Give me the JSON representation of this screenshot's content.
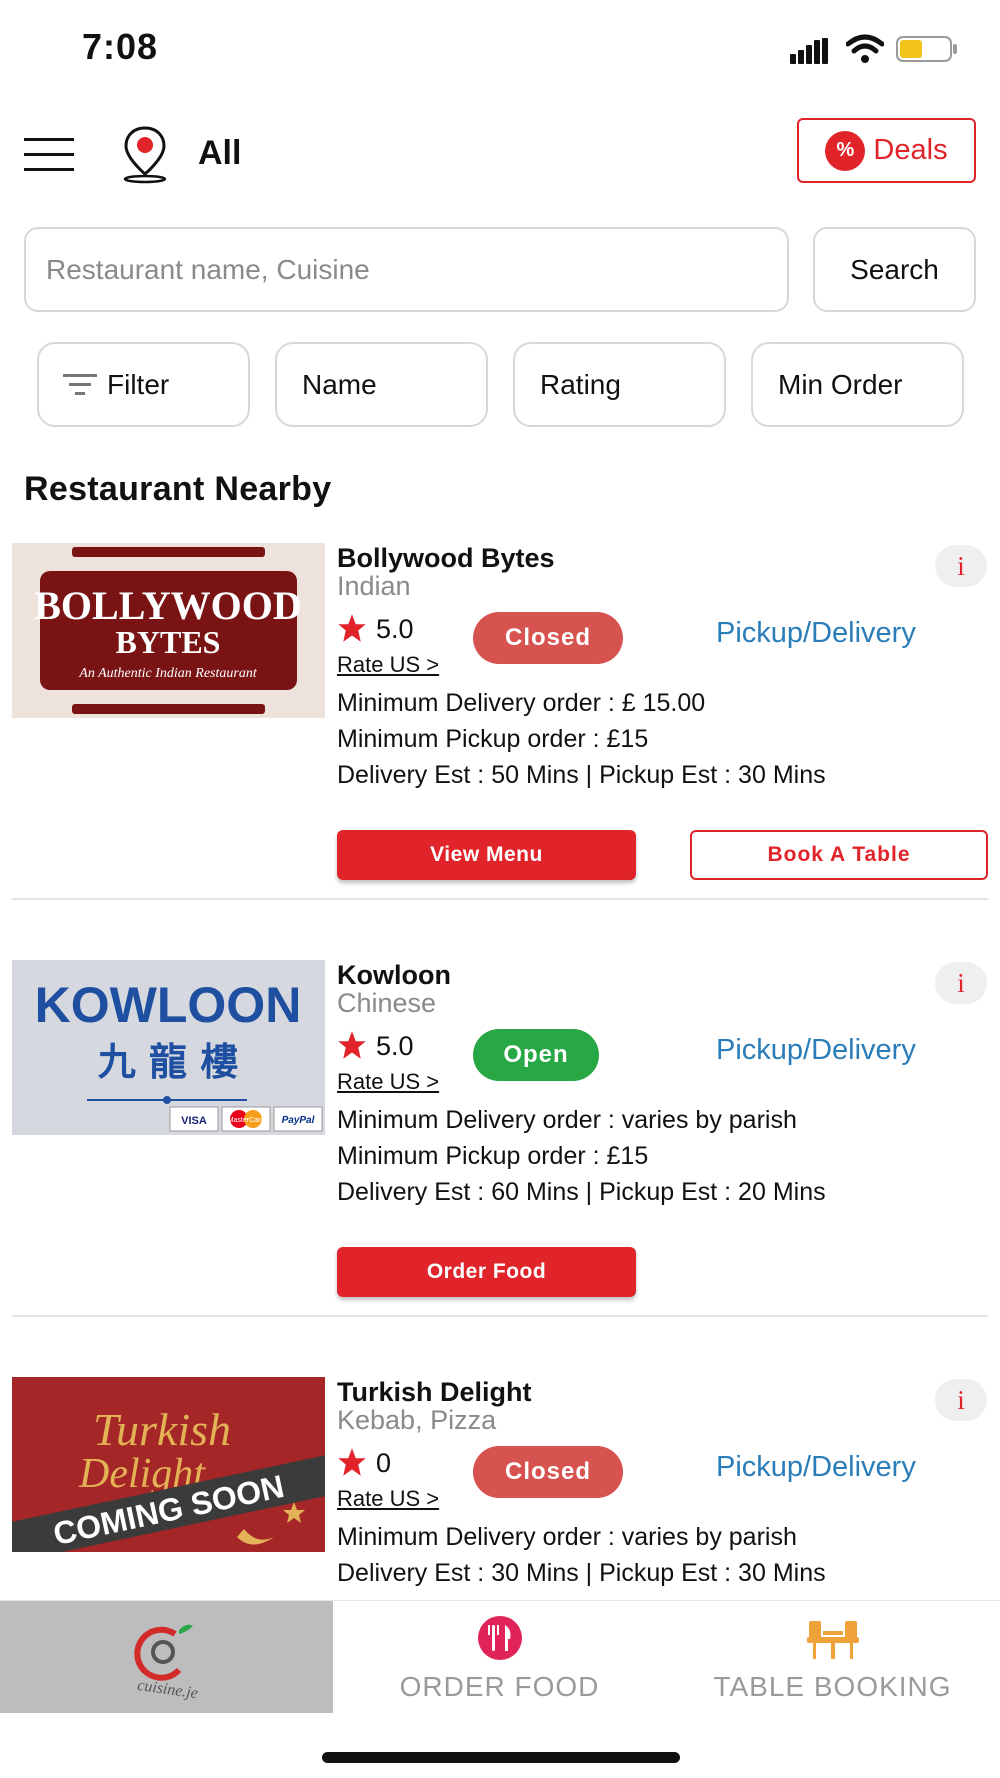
{
  "status_bar": {
    "time": "7:08"
  },
  "header": {
    "location": "All",
    "deals_label": "Deals",
    "deals_badge": "%"
  },
  "search": {
    "placeholder": "Restaurant name, Cuisine",
    "value": "",
    "button_label": "Search"
  },
  "sort_chips": {
    "filter": "Filter",
    "name": "Name",
    "rating": "Rating",
    "min_order": "Min Order"
  },
  "section_title": "Restaurant Nearby",
  "restaurants": [
    {
      "name": "Bollywood Bytes",
      "cuisine": "Indian",
      "rating": "5.0",
      "rate_link": "Rate US >",
      "status": "Closed",
      "service": "Pickup/Delivery",
      "min_delivery": "Minimum Delivery order : £ 15.00",
      "min_pickup": "Minimum Pickup order : £15",
      "est": "Delivery Est : 50 Mins | Pickup Est : 30 Mins",
      "primary_button": "View Menu",
      "secondary_button": "Book A Table",
      "logo": {
        "line1": "BOLLYWOOD",
        "line2": "BYTES",
        "tagline": "An Authentic Indian Restaurant"
      }
    },
    {
      "name": "Kowloon",
      "cuisine": "Chinese",
      "rating": "5.0",
      "rate_link": "Rate US >",
      "status": "Open",
      "service": "Pickup/Delivery",
      "min_delivery": "Minimum Delivery order : varies by parish",
      "min_pickup": "Minimum Pickup order : £15",
      "est": "Delivery Est : 60 Mins | Pickup Est : 20 Mins",
      "primary_button": "Order Food",
      "logo": {
        "line1": "KOWLOON",
        "line2": "九 龍 樓",
        "cards": [
          "VISA",
          "MasterCard",
          "PayPal"
        ]
      }
    },
    {
      "name": "Turkish Delight",
      "cuisine": "Kebab, Pizza",
      "rating": "0",
      "rate_link": "Rate US >",
      "status": "Closed",
      "service": "Pickup/Delivery",
      "min_delivery": "Minimum Delivery order : varies by parish",
      "est": "Delivery Est : 30 Mins | Pickup Est : 30 Mins",
      "logo": {
        "line1": "Turkish",
        "line2": "Delight",
        "banner": "COMING SOON"
      }
    }
  ],
  "bottom_nav": {
    "home_logo": "cuisine.je",
    "order_food": "ORDER FOOD",
    "table_booking": "TABLE BOOKING"
  },
  "colors": {
    "brand_red": "#e0242a",
    "closed": "#d7534f",
    "open": "#27a844",
    "link_blue": "#2a7db8"
  },
  "icons": [
    "menu-icon",
    "location-pin-icon",
    "percent-icon",
    "filter-icon",
    "star-icon",
    "info-icon",
    "fork-knife-icon",
    "table-chairs-icon"
  ]
}
